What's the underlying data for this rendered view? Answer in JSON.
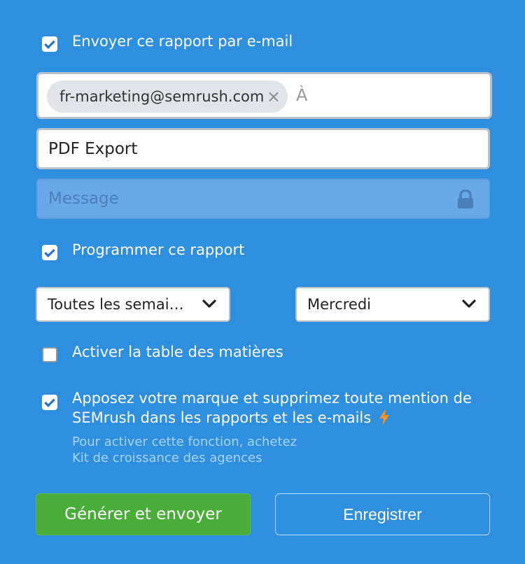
{
  "email_section": {
    "checkbox_checked": true,
    "label": "Envoyer ce rapport par e-mail",
    "recipient_chip": "fr-marketing@semrush.com",
    "recipient_remove": "×",
    "to_placeholder": "À",
    "subject_value": "PDF Export",
    "message_placeholder": "Message"
  },
  "schedule_section": {
    "checkbox_checked": true,
    "label": "Programmer ce rapport",
    "frequency_selected": "Toutes les semai…",
    "day_selected": "Mercredi"
  },
  "toc_section": {
    "checkbox_checked": false,
    "label": "Activer la table des matières"
  },
  "branding_section": {
    "checkbox_checked": true,
    "label_line1": "Apposez votre marque et supprimez toute mention de",
    "label_line2": "SEMrush dans les rapports et les e-mails",
    "hint_line1": "Pour activer cette fonction, achetez",
    "hint_line2": "Kit de croissance des agences"
  },
  "actions": {
    "generate_label": "Générer et envoyer",
    "save_label": "Enregistrer"
  },
  "colors": {
    "background": "#2E8FDF",
    "primary_button": "#4AAD3A",
    "lightning_icon": "#F7931E"
  }
}
